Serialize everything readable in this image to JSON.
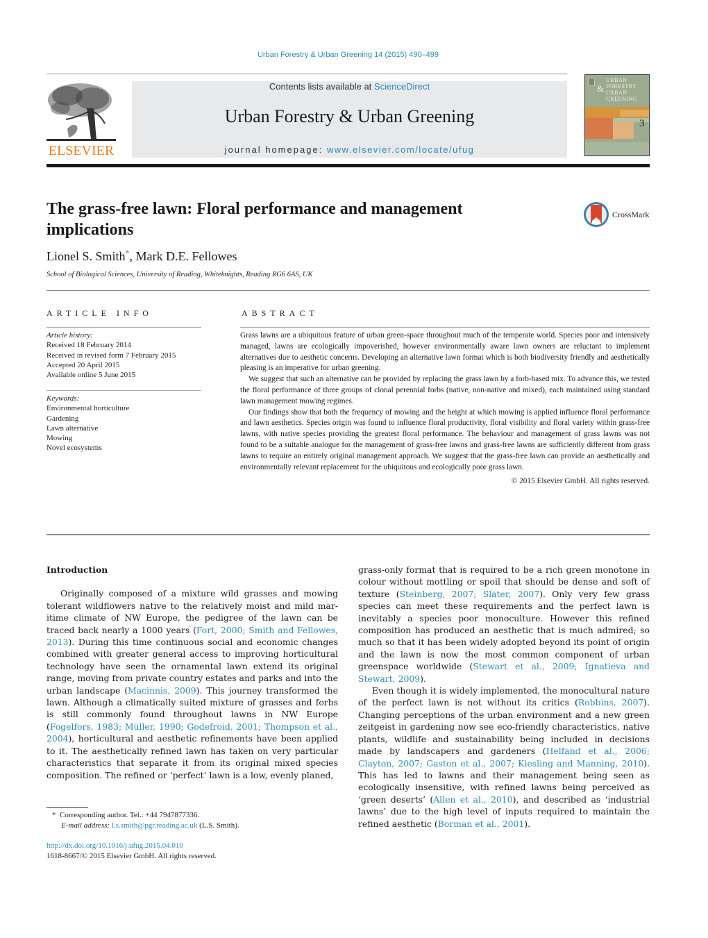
{
  "journal_citation": "Urban Forestry & Urban Greening 14 (2015) 490–499",
  "masthead": {
    "contents_prefix": "Contents lists available at ",
    "contents_link": "ScienceDirect",
    "journal_title": "Urban Forestry & Urban Greening",
    "homepage_prefix": "journal homepage: ",
    "homepage_link": "www.elsevier.com/locate/ufug",
    "publisher_logo_text": "ELSEVIER",
    "cover": {
      "line1": "URBAN",
      "line2": "FORESTRY",
      "line3": "URBAN",
      "line4": "GREENING",
      "amp": "&",
      "issue_number": "3"
    }
  },
  "article": {
    "title": "The grass-free lawn: Floral performance and management implications",
    "crossmark_label": "CrossMark",
    "authors": [
      {
        "name": "Lionel S. Smith",
        "marker": "*"
      },
      {
        "name": "Mark D.E. Fellowes",
        "marker": ""
      }
    ],
    "author_separator": ", ",
    "affiliation": "School of Biological Sciences, University of Reading, Whiteknights, Reading RG6 6AS, UK"
  },
  "article_info": {
    "heading": "ARTICLE INFO",
    "history_label": "Article history:",
    "history": [
      "Received 18 February 2014",
      "Received in revised form 7 February 2015",
      "Accepted 20 April 2015",
      "Available online 5 June 2015"
    ],
    "keywords_label": "Keywords:",
    "keywords": [
      "Environmental horticulture",
      "Gardening",
      "Lawn alternative",
      "Mowing",
      "Novel ecosystems"
    ]
  },
  "abstract": {
    "heading": "ABSTRACT",
    "paragraphs": [
      "Grass lawns are a ubiquitous feature of urban green-space throughout much of the temperate world. Species poor and intensively managed, lawns are ecologically impoverished, however environmentally aware lawn owners are reluctant to implement alternatives due to aesthetic concerns. Developing an alternative lawn format which is both biodiversity friendly and aesthetically pleasing is an imperative for urban greening.",
      "We suggest that such an alternative can be provided by replacing the grass lawn by a forb-based mix. To advance this, we tested the floral performance of three groups of clonal perennial forbs (native, non-native and mixed), each maintained using standard lawn management mowing regimes.",
      "Our findings show that both the frequency of mowing and the height at which mowing is applied influence floral performance and lawn aesthetics. Species origin was found to influence floral productivity, floral visibility and floral variety within grass-free lawns, with native species providing the greatest floral performance. The behaviour and management of grass lawns was not found to be a suitable analogue for the management of grass-free lawns and grass-free lawns are sufficiently different from grass lawns to require an entirely original management approach. We suggest that the grass-free lawn can provide an aesthetically and environmentally relevant replacement for the ubiquitous and ecologically poor grass lawn."
    ],
    "copyright": "© 2015 Elsevier GmbH. All rights reserved."
  },
  "body": {
    "section_heading": "Introduction",
    "left": {
      "p1_a": "Originally composed of a mixture wild grasses and mowing tolerant wildflowers native to the relatively moist and mild mar­itime climate of NW Europe, the pedigree of the lawn can be traced back nearly a 1000 years (",
      "p1_ref1": "Fort, 2000; Smith and Fellowes, 2013",
      "p1_b": "). During this time continuous social and economic changes combined with greater general access to improving horticultural technology have seen the ornamental lawn extend its original range, moving from private country estates and parks and into the urban landscape (",
      "p1_ref2": "Macinnis, 2009",
      "p1_c": "). This journey transformed the lawn. Although a climatically suited mixture of grasses and forbs is still commonly found throughout lawns in NW Europe (",
      "p1_ref3": "Fogelfors, 1983; Müller, 1990; Godefroid, 2001; Thompson et al., 2004",
      "p1_d": "), horticultural and aesthetic refinements have been applied to it. The aesthetically refined lawn has taken on very particu­lar characteristics that separate it from its original mixed species composition. The refined or ‘perfect’ lawn is a low, evenly planed,"
    },
    "right": {
      "p1_a": "grass-only format that is required to be a rich green monotone in colour without mottling or spoil that should be dense and soft of texture (",
      "p1_ref1": "Steinberg, 2007; Slater, 2007",
      "p1_b": "). Only very few grass species can meet these requirements and the perfect lawn is inevitably a species poor monoculture. However this refined composition has produced an aesthetic that is much admired; so much so that it has been widely adopted beyond its point of ori­gin and the lawn is now the most common component of urban greenspace worldwide (",
      "p1_ref2": "Stewart et al., 2009; Ignatieva and Stewart, 2009",
      "p1_c": ").",
      "p2_a": "Even though it is widely implemented, the monocultural nature of the perfect lawn is not without its critics (",
      "p2_ref1": "Robbins, 2007",
      "p2_b": "). Chang­ing perceptions of the urban environment and a new green zeitgeist in gardening now see eco-friendly characteristics, native plants, wildlife and sustainability being included in decisions made by landscapers and gardeners (",
      "p2_ref2": "Helfand et al., 2006; Clayton, 2007; Gaston et al., 2007; Kiesling and Manning, 2010",
      "p2_c": "). This has led to lawns and their management being seen as ecologically insensi­tive, with refined lawns being perceived as ‘green deserts’ (",
      "p2_ref3": "Allen et al., 2010",
      "p2_d": "), and described as ‘industrial lawns’ due to the high level of inputs required to maintain the refined aesthetic (",
      "p2_ref4": "Borman et al., 2001",
      "p2_e": ")."
    }
  },
  "footnote": {
    "marker": "*",
    "corresponding": "Corresponding author. Tel.: +44 7947877336.",
    "email_label": "E-mail address: ",
    "email": "l.s.smith@pgr.reading.ac.uk",
    "email_suffix": " (L.S. Smith)."
  },
  "doi": {
    "link": "http://dx.doi.org/10.1016/j.ufug.2015.04.010",
    "issn_line": "1618-8667/© 2015 Elsevier GmbH. All rights reserved."
  },
  "colors": {
    "link": "#2a8ab8",
    "elsevier_orange": "#f07f1c",
    "masthead_bg": "#e8e9ea"
  }
}
